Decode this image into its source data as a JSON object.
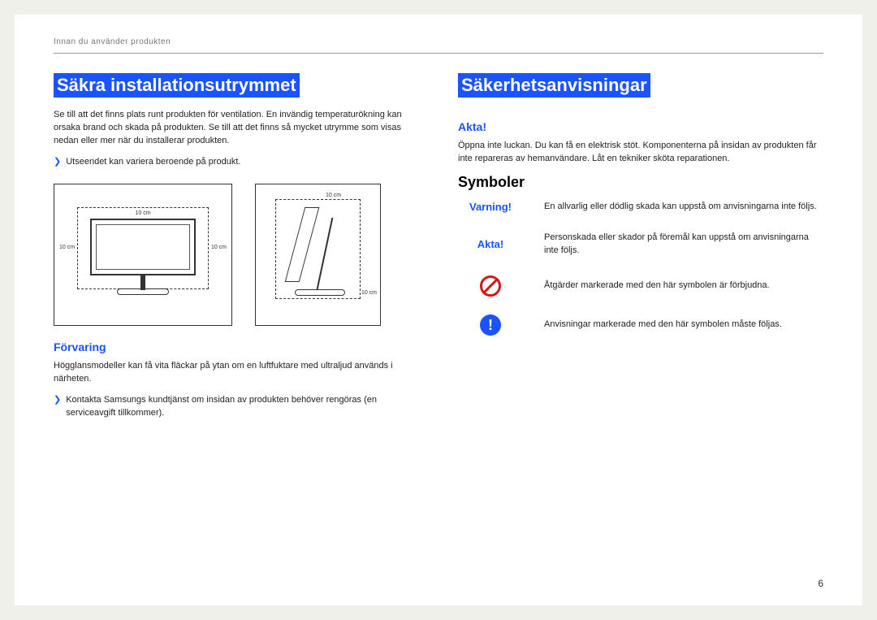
{
  "header": "Innan du använder produkten",
  "page_number": "6",
  "left": {
    "title": "Säkra installationsutrymmet",
    "intro": "Se till att det finns plats runt produkten för ventilation. En invändig temperaturökning kan orsaka brand och skada på produkten. Se till att det finns så mycket utrymme som visas nedan eller mer när du installerar produkten.",
    "bullet1": "Utseendet kan variera beroende på produkt.",
    "dist_top": "10 cm",
    "dist_left": "10 cm",
    "dist_right": "10 cm",
    "dist_back": "10 cm",
    "dist_front": "10 cm",
    "storage_heading": "Förvaring",
    "storage_text": "Högglansmodeller kan få vita fläckar på ytan om en luftfuktare med ultraljud används i närheten.",
    "bullet2": "Kontakta Samsungs kundtjänst om insidan av produkten behöver rengöras (en serviceavgift tillkommer)."
  },
  "right": {
    "title": "Säkerhetsanvisningar",
    "akta_heading": "Akta!",
    "akta_text": "Öppna inte luckan. Du kan få en elektrisk stöt. Komponenterna på insidan av produkten får inte repareras av hemanvändare. Låt en tekniker sköta reparationen.",
    "symbols_heading": "Symboler",
    "row_warn_label": "Varning!",
    "row_warn_text": "En allvarlig eller dödlig skada kan uppstå om anvisningarna inte följs.",
    "row_akta_label": "Akta!",
    "row_akta_text": "Personskada eller skador på föremål kan uppstå om anvisningarna inte följs.",
    "row_prohibit_text": "Åtgärder markerade med den här symbolen är förbjudna.",
    "row_must_text": "Anvisningar markerade med den här symbolen måste följas."
  }
}
